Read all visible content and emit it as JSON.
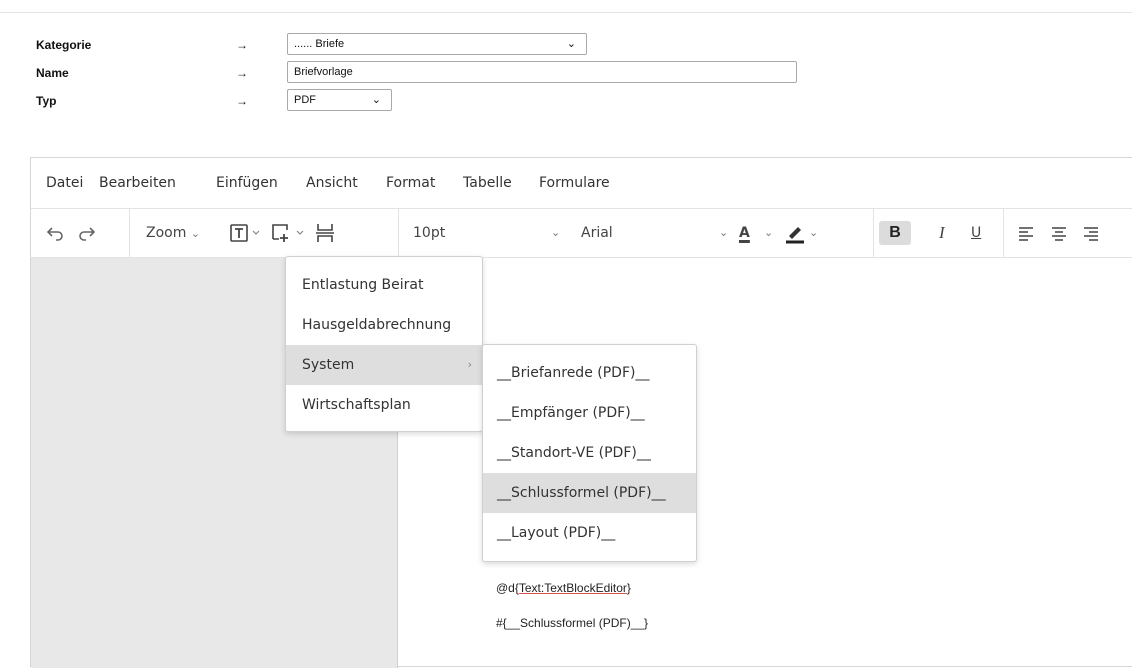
{
  "form": {
    "kategorie": {
      "label": "Kategorie",
      "arrow": "→",
      "value": "...... Briefe"
    },
    "name": {
      "label": "Name",
      "arrow": "→",
      "value": "Briefvorlage"
    },
    "typ": {
      "label": "Typ",
      "arrow": "→",
      "value": "PDF"
    }
  },
  "menubar": [
    "Datei",
    "Bearbeiten",
    "Einfügen",
    "Ansicht",
    "Format",
    "Tabelle",
    "Formulare"
  ],
  "toolbar": {
    "zoom_label": "Zoom",
    "font_size": "10pt",
    "font_family": "Arial",
    "text_color_letter": "A",
    "bold": "B",
    "italic": "I",
    "underline": "U"
  },
  "dropdown_main": {
    "items": [
      "Entlastung Beirat",
      "Hausgeldabrechnung",
      "System",
      "Wirtschaftsplan"
    ],
    "active": "System"
  },
  "dropdown_sub": {
    "items": [
      "__Briefanrede (PDF)__",
      "__Empfänger (PDF)__",
      "__Standort-VE (PDF)__",
      "__Schlussformel (PDF)__",
      "__Layout (PDF)__"
    ],
    "active": "__Schlussformel (PDF)__"
  },
  "document": {
    "line1_prefix": "@d{",
    "line1_link": "Text:TextBlockEditor",
    "line1_suffix": "}",
    "line2": "#{__Schlussformel (PDF)__}"
  },
  "colors": {
    "active_item": "#dedede",
    "bold_active": "#dcdcdc",
    "sidepanel": "#e8e8e8"
  }
}
